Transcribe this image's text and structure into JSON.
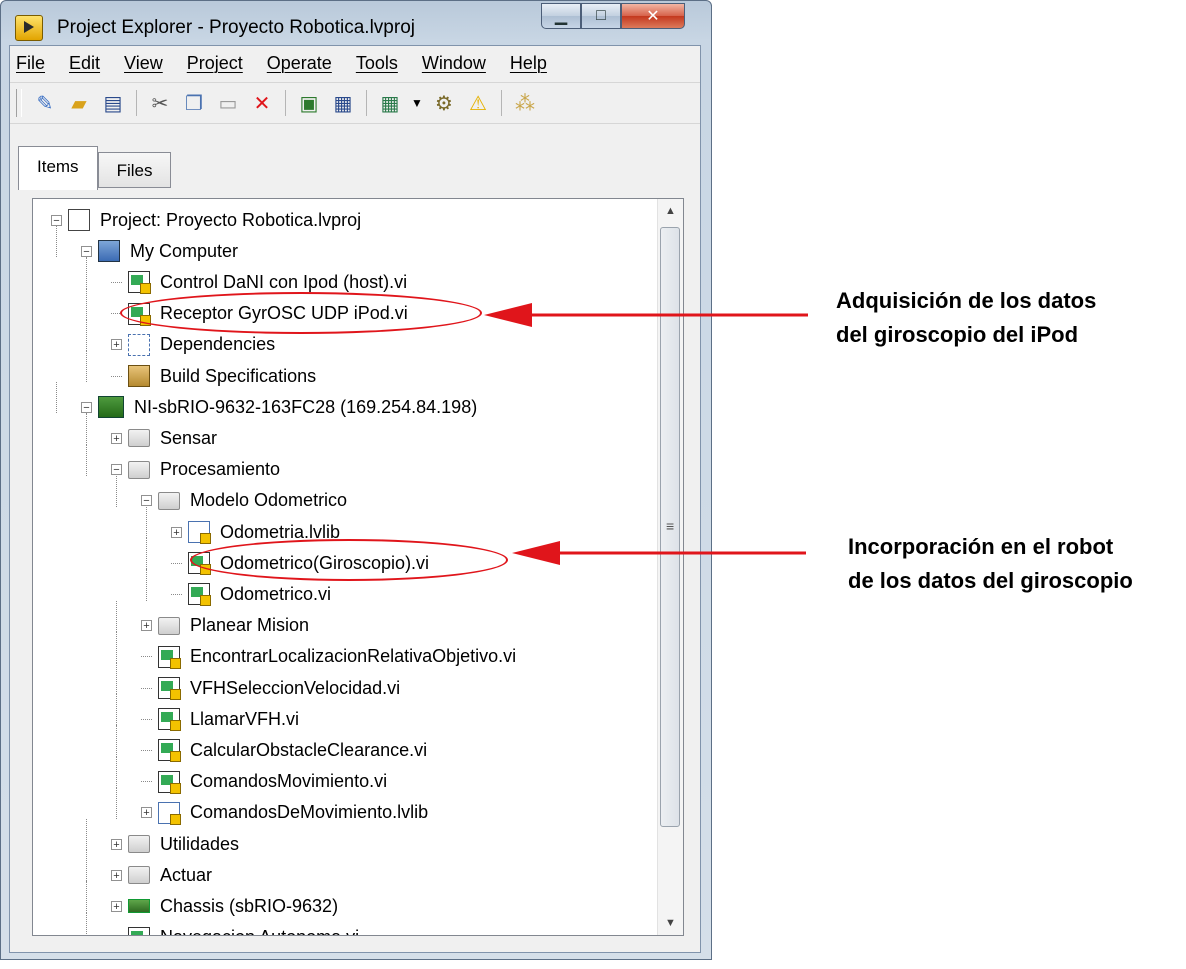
{
  "window": {
    "title": "Project Explorer - Proyecto Robotica.lvproj",
    "minimize_icon": "minimize-icon",
    "maximize_icon": "maximize-icon",
    "close_icon": "close-icon",
    "min_glyph": "▁",
    "max_glyph": "□",
    "close_glyph": "✕"
  },
  "menu": [
    "File",
    "Edit",
    "View",
    "Project",
    "Operate",
    "Tools",
    "Window",
    "Help"
  ],
  "toolbar_icons": [
    "new-icon",
    "open-icon",
    "save-all-icon",
    "cut-icon",
    "copy-icon",
    "paste-icon",
    "delete-icon",
    "build-icon",
    "deploy-icon",
    "view-icon",
    "dropdown-icon",
    "properties-icon",
    "warning-icon",
    "dependency-icon"
  ],
  "tabs": [
    {
      "label": "Items",
      "active": true
    },
    {
      "label": "Files",
      "active": false
    }
  ],
  "tree": [
    {
      "label": "Project: Proyecto Robotica.lvproj",
      "icon": "project-icon",
      "expander": "−"
    },
    {
      "label": "My Computer",
      "icon": "computer-icon",
      "expander": "−"
    },
    {
      "label": "Control DaNI con Ipod (host).vi",
      "icon": "vi-icon",
      "expander": ""
    },
    {
      "label": "Receptor GyrOSC UDP iPod.vi",
      "icon": "vi-icon",
      "expander": ""
    },
    {
      "label": "Dependencies",
      "icon": "dependencies-icon",
      "expander": "+"
    },
    {
      "label": "Build Specifications",
      "icon": "build-specifications-icon",
      "expander": ""
    },
    {
      "label": "NI-sbRIO-9632-163FC28 (169.254.84.198)",
      "icon": "rt-target-icon",
      "expander": "−"
    },
    {
      "label": "Sensar",
      "icon": "folder-icon",
      "expander": "+"
    },
    {
      "label": "Procesamiento",
      "icon": "folder-icon",
      "expander": "−"
    },
    {
      "label": "Modelo Odometrico",
      "icon": "folder-icon",
      "expander": "−"
    },
    {
      "label": "Odometria.lvlib",
      "icon": "library-icon",
      "expander": "+"
    },
    {
      "label": "Odometrico(Giroscopio).vi",
      "icon": "vi-icon",
      "expander": ""
    },
    {
      "label": "Odometrico.vi",
      "icon": "vi-icon",
      "expander": ""
    },
    {
      "label": "Planear Mision",
      "icon": "folder-icon",
      "expander": "+"
    },
    {
      "label": "EncontrarLocalizacionRelativaObjetivo.vi",
      "icon": "vi-icon",
      "expander": ""
    },
    {
      "label": "VFHSeleccionVelocidad.vi",
      "icon": "vi-icon",
      "expander": ""
    },
    {
      "label": "LlamarVFH.vi",
      "icon": "vi-icon",
      "expander": ""
    },
    {
      "label": "CalcularObstacleClearance.vi",
      "icon": "vi-icon",
      "expander": ""
    },
    {
      "label": "ComandosMovimiento.vi",
      "icon": "vi-icon",
      "expander": ""
    },
    {
      "label": "ComandosDeMovimiento.lvlib",
      "icon": "library-icon",
      "expander": "+"
    },
    {
      "label": "Utilidades",
      "icon": "folder-icon",
      "expander": "+"
    },
    {
      "label": "Actuar",
      "icon": "folder-icon",
      "expander": "+"
    },
    {
      "label": "Chassis (sbRIO-9632)",
      "icon": "chassis-icon",
      "expander": "+"
    },
    {
      "label": "Navegacion Autonoma.vi",
      "icon": "vi-icon",
      "expander": ""
    }
  ],
  "scrollbar": {
    "up_glyph": "▲",
    "down_glyph": "▼",
    "grip_glyph": "≡"
  },
  "annotations": [
    {
      "line1": "Adquisición de los datos",
      "line2": "del giroscopio del iPod"
    },
    {
      "line1": "Incorporación en el robot",
      "line2": "de los datos del giroscopio"
    }
  ],
  "colors": {
    "annotation": "#e0151b"
  }
}
